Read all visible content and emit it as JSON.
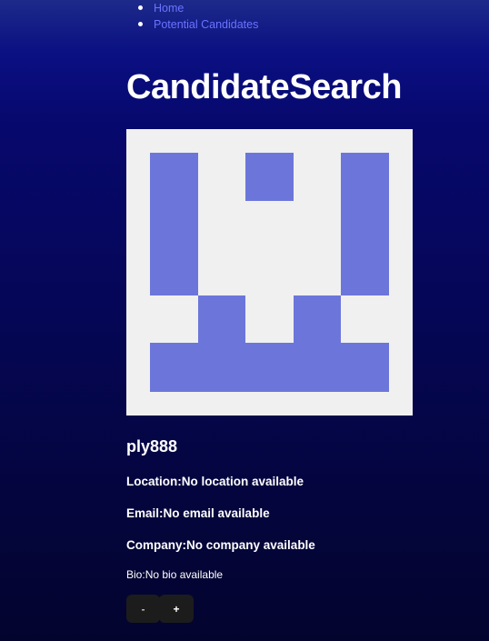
{
  "nav": {
    "items": [
      {
        "label": "Home"
      },
      {
        "label": "Potential Candidates"
      }
    ]
  },
  "page": {
    "title": "CandidateSearch"
  },
  "candidate": {
    "username": "ply888",
    "location_label": "Location:",
    "location_value": "No location available",
    "email_label": "Email:",
    "email_value": "No email available",
    "company_label": "Company:",
    "company_value": "No company available",
    "bio_label": "Bio:",
    "bio_value": "No bio available"
  },
  "actions": {
    "reject_label": "-",
    "accept_label": "+"
  },
  "colors": {
    "nav_link": "#6b73ff",
    "identicon_fill": "#6c76da",
    "identicon_background": "#f0f0f0",
    "button_background": "#1c1c1c"
  },
  "icons": {
    "avatar": "identicon"
  }
}
